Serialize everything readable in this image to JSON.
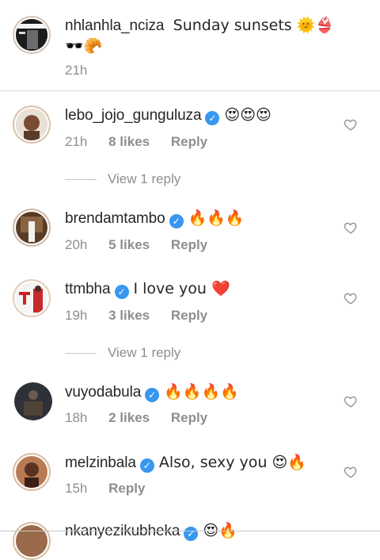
{
  "caption": {
    "username": "nhlanhla_nciza",
    "text": "Sunday sunsets 🌞👙",
    "text_line2": "🕶️🥐",
    "time": "21h"
  },
  "comments": [
    {
      "username": "lebo_jojo_gunguluza",
      "verified": true,
      "text": "😍😍😍",
      "time": "21h",
      "likes": "8 likes",
      "reply": "Reply",
      "view_replies": "View 1 reply"
    },
    {
      "username": "brendamtambo",
      "verified": true,
      "text": "🔥🔥🔥",
      "time": "20h",
      "likes": "5 likes",
      "reply": "Reply"
    },
    {
      "username": "ttmbha",
      "verified": true,
      "text": "I love you ❤️",
      "time": "19h",
      "likes": "3 likes",
      "reply": "Reply",
      "view_replies": "View 1 reply"
    },
    {
      "username": "vuyodabula",
      "verified": true,
      "text": "🔥🔥🔥🔥",
      "time": "18h",
      "likes": "2 likes",
      "reply": "Reply"
    },
    {
      "username": "melzinbala",
      "verified": true,
      "text": "Also, sexy you 😍🔥",
      "time": "15h",
      "reply": "Reply"
    },
    {
      "username": "nkanyezikubheka",
      "verified": true,
      "text": "😍🔥"
    }
  ],
  "icons": {
    "heart": "heart-outline-icon",
    "verified": "verified-badge-icon"
  },
  "colors": {
    "verified": "#3897f0",
    "muted": "#8e8e8e",
    "text": "#262626"
  }
}
